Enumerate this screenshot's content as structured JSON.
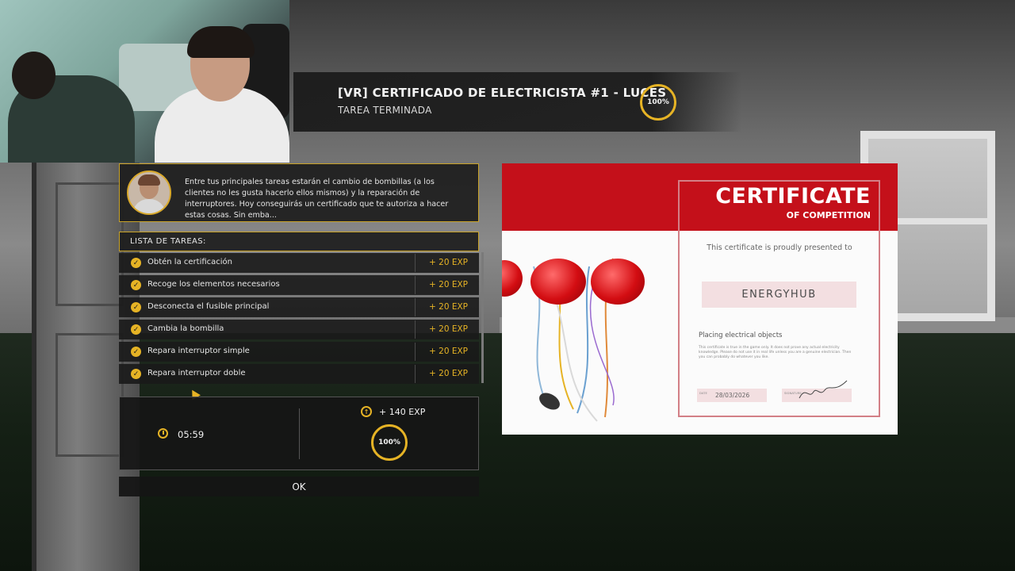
{
  "banner": {
    "title": "[VR] CERTIFICADO DE ELECTRICISTA #1 - LUCES",
    "status": "TAREA TERMINADA",
    "progress_label": "100%",
    "progress": 1.0
  },
  "mission": {
    "description": "Entre tus principales tareas estarán el cambio de bombillas (a los clientes no les gusta hacerlo ellos mismos) y la reparación de interruptores. Hoy conseguirás un certificado que te autoriza a hacer estas cosas. Sin emba..."
  },
  "tasks": {
    "header": "LISTA DE TAREAS:",
    "items": [
      {
        "label": "Obtén la certificación",
        "exp": "+ 20 EXP",
        "done": true
      },
      {
        "label": "Recoge los elementos necesarios",
        "exp": "+ 20 EXP",
        "done": true
      },
      {
        "label": "Desconecta el fusible principal",
        "exp": "+ 20 EXP",
        "done": true
      },
      {
        "label": "Cambia la bombilla",
        "exp": "+ 20 EXP",
        "done": true
      },
      {
        "label": "Repara interruptor simple",
        "exp": "+ 20 EXP",
        "done": true
      },
      {
        "label": "Repara interruptor doble",
        "exp": "+ 20 EXP",
        "done": true
      }
    ]
  },
  "summary": {
    "time": "05:59",
    "total_exp": "+ 140 EXP",
    "progress_label": "100%",
    "progress": 1.0
  },
  "ok_label": "OK",
  "certificate": {
    "title": "CERTIFICATE",
    "subtitle": "OF COMPETITION",
    "presented_to": "This certificate is proudly presented to",
    "name": "ENERGYHUB",
    "course": "Placing electrical objects",
    "fine_print": "This certificate is true in the game only. It does not prove any actual electricity knowledge. Please do not use it in real life unless you are a genuine electrician. Then you can probably do whatever you like.",
    "date_label": "DATE",
    "date": "28/03/2026",
    "signature_label": "SIGNATURE"
  },
  "colors": {
    "accent": "#e6b325",
    "certificate_red": "#c4101a",
    "panel_bg": "#1e1e1e"
  },
  "icons": {
    "check": "check-circle-icon",
    "clock": "clock-icon",
    "xp": "xp-up-arrow-icon",
    "cursor": "pointer-cursor-icon"
  }
}
